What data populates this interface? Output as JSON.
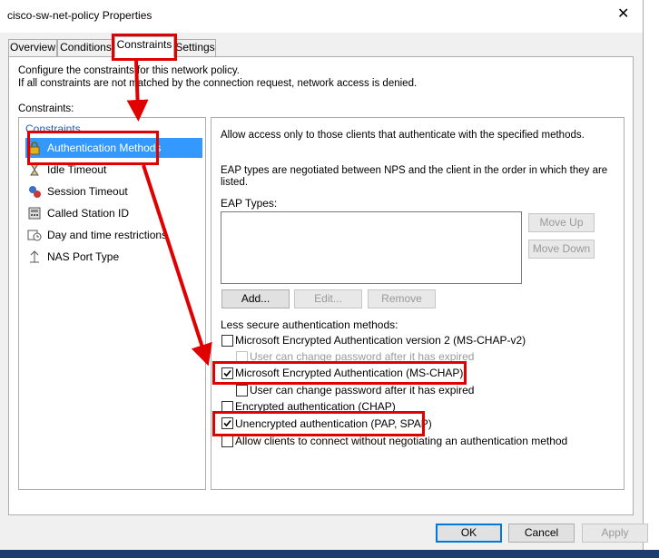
{
  "window": {
    "title": "cisco-sw-net-policy Properties",
    "close_icon": "close-icon"
  },
  "tabs": [
    {
      "label": "Overview",
      "active": false
    },
    {
      "label": "Conditions",
      "active": false
    },
    {
      "label": "Constraints",
      "active": true
    },
    {
      "label": "Settings",
      "active": false
    }
  ],
  "description": {
    "line1": "Configure the constraints for this network policy.",
    "line2": "If all constraints are not matched by the connection request, network access is denied."
  },
  "constraints_label": "Constraints:",
  "tree": {
    "header": "Constraints",
    "items": [
      {
        "label": "Authentication Methods",
        "icon": "lock-icon",
        "selected": true
      },
      {
        "label": "Idle Timeout",
        "icon": "hourglass-icon",
        "selected": false
      },
      {
        "label": "Session Timeout",
        "icon": "session-timeout-icon",
        "selected": false
      },
      {
        "label": "Called Station ID",
        "icon": "phone-icon",
        "selected": false
      },
      {
        "label": "Day and time restrictions",
        "icon": "calendar-icon",
        "selected": false
      },
      {
        "label": "NAS Port Type",
        "icon": "network-port-icon",
        "selected": false
      }
    ]
  },
  "details": {
    "intro": "Allow access only to those clients that authenticate with the specified methods.",
    "eap_note_line1": "EAP types are negotiated between NPS and the client in the order in which they are",
    "eap_note_line2": "listed.",
    "eap_types_label": "EAP Types:",
    "eap_types": [],
    "move_up": "Move Up",
    "move_down": "Move Down",
    "add": "Add...",
    "edit": "Edit...",
    "remove": "Remove",
    "less_secure_label": "Less secure authentication methods:",
    "methods": [
      {
        "label": "Microsoft Encrypted Authentication version 2 (MS-CHAP-v2)",
        "checked": false,
        "enabled": true,
        "indent": false
      },
      {
        "label": "User can change password after it has expired",
        "checked": false,
        "enabled": false,
        "indent": true
      },
      {
        "label": "Microsoft Encrypted Authentication (MS-CHAP)",
        "checked": true,
        "enabled": true,
        "indent": false
      },
      {
        "label": "User can change password after it has expired",
        "checked": false,
        "enabled": true,
        "indent": true
      },
      {
        "label": "Encrypted authentication (CHAP)",
        "checked": false,
        "enabled": true,
        "indent": false
      },
      {
        "label": "Unencrypted authentication (PAP, SPAP)",
        "checked": true,
        "enabled": true,
        "indent": false
      },
      {
        "label": "Allow clients to connect without negotiating an authentication method",
        "checked": false,
        "enabled": true,
        "indent": false
      }
    ]
  },
  "footer": {
    "ok": "OK",
    "cancel": "Cancel",
    "apply": "Apply"
  },
  "annotation_color": "#e00000",
  "selection_color": "#3399ff"
}
